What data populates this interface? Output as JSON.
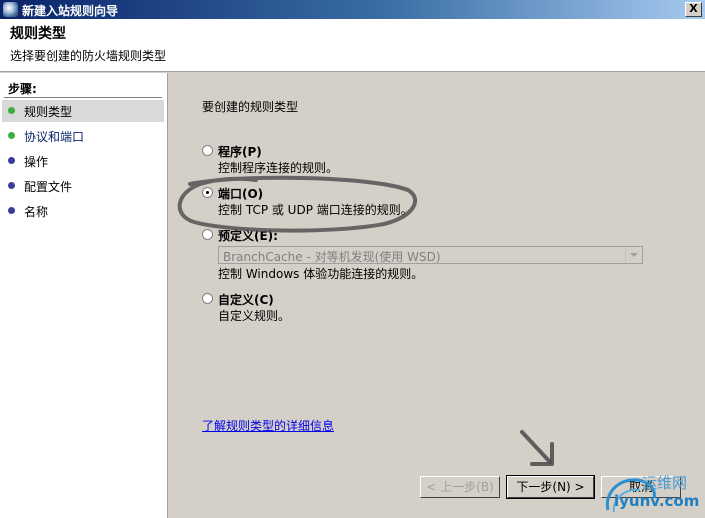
{
  "window": {
    "title": "新建入站规则向导",
    "close_label": "X"
  },
  "header": {
    "title": "规则类型",
    "subtitle": "选择要创建的防火墙规则类型"
  },
  "sidebar": {
    "steps_title": "步骤:",
    "items": [
      {
        "label": "规则类型",
        "dot_color": "#3cae3c"
      },
      {
        "label": "协议和端口",
        "dot_color": "#3cae3c"
      },
      {
        "label": "操作",
        "dot_color": "#3a3aa0"
      },
      {
        "label": "配置文件",
        "dot_color": "#3a3aa0"
      },
      {
        "label": "名称",
        "dot_color": "#3a3aa0"
      }
    ]
  },
  "content": {
    "prompt": "要创建的规则类型",
    "options": [
      {
        "label": "程序(P)",
        "desc": "控制程序连接的规则。",
        "checked": false
      },
      {
        "label": "端口(O)",
        "desc": "控制 TCP 或 UDP 端口连接的规则。",
        "checked": true
      },
      {
        "label": "预定义(E):",
        "desc": "控制 Windows 体验功能连接的规则。",
        "checked": false
      },
      {
        "label": "自定义(C)",
        "desc": "自定义规则。",
        "checked": false
      }
    ],
    "predefined_select": "BranchCache - 对等机发现(使用 WSD)",
    "learn_more_link": "了解规则类型的详细信息"
  },
  "buttons": {
    "back": "< 上一步(B)",
    "next": "下一步(N) >",
    "cancel": "取消"
  },
  "watermark": {
    "cn": "运维网",
    "url": "iyunv.com"
  }
}
